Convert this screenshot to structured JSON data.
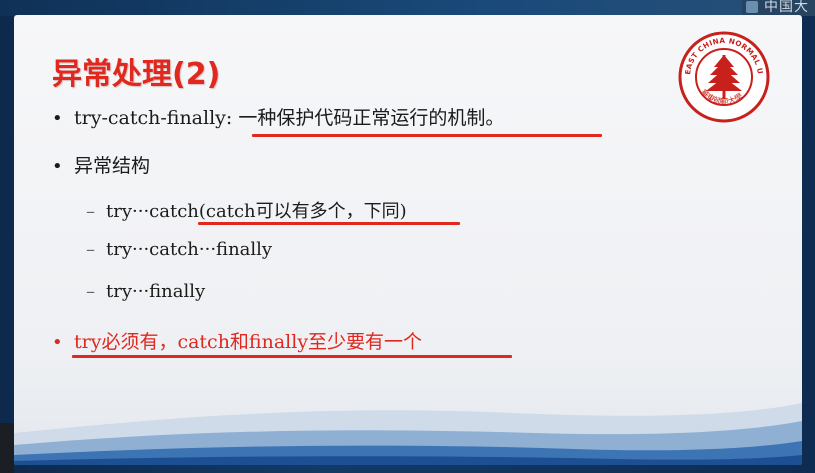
{
  "watermark": {
    "text": "中国大"
  },
  "slide": {
    "title": "异常处理(2)",
    "seal": {
      "outer_text": "EAST CHINA NORMAL UNIVERSITY",
      "inner_text": "華東師範大學"
    },
    "bullets": [
      {
        "marker": "•",
        "prefix": "try-catch-finally: ",
        "text": "一种保护代码正常运行的机制。"
      },
      {
        "marker": "•",
        "text": "异常结构"
      }
    ],
    "sub_items": [
      {
        "marker": "–",
        "prefix": "try···catch",
        "text": "(catch可以有多个，下同)"
      },
      {
        "marker": "–",
        "text": "try···catch···finally"
      },
      {
        "marker": "–",
        "text": "try···finally"
      }
    ],
    "highlight_bullet": {
      "marker": "•",
      "text": "try必须有，catch和finally至少要有一个"
    },
    "colors": {
      "accent_red": "#e0281e",
      "seal_red": "#c8201a"
    }
  }
}
